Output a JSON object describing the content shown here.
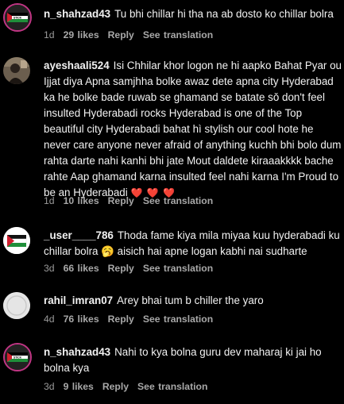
{
  "comments": [
    {
      "username": "n_shahzad43",
      "text": "Tu bhi chillar hi tha na ab dosto ko chillar bolra",
      "time": "1d",
      "likes": "29 likes",
      "reply": "Reply",
      "see_translation": "See translation",
      "avatar_icon": "flag-avatar-icon"
    },
    {
      "username": "ayeshaali524",
      "text": "Isi Chhilar khor logon ne hi aapko Bahat Pyar ou Ijjat diya Apna samjhha bolke awaz dete apna city Hyderabad ka he bolke bade ruwab se ghamand se batate sǒ don't feel insulted Hyderabadi rocks Hyderabad is one of the Top beautiful city Hyderabadi bahat hì stylish our cool hote he never care anyone never afraid of anything kuchh bhi bolo dum rahta darte nahi kanhi bhi jate Mout daldete kiraaakkkk bache rahte Aap ghamand karna insulted feel nahi karna I'm Proud to be an Hyderabadi",
      "emoji": "❤️ ❤️ ❤️",
      "time": "1d",
      "likes": "10 likes",
      "reply": "Reply",
      "see_translation": "See translation",
      "avatar_icon": "profile-photo-icon"
    },
    {
      "username": "_user____786",
      "text": "Thoda fame kiya mila miyaa kuu hyderabadi ku chillar bolra",
      "emoji": "🥱",
      "text2": "aisich hai apne logan kabhi nai sudharte",
      "time": "3d",
      "likes": "66 likes",
      "reply": "Reply",
      "see_translation": "See translation",
      "avatar_icon": "flag-avatar-icon"
    },
    {
      "username": "rahil_imran07",
      "text": "Arey bhai tum b chiller the yaro",
      "time": "4d",
      "likes": "76 likes",
      "reply": "Reply",
      "see_translation": "See translation",
      "avatar_icon": "default-avatar-icon"
    },
    {
      "username": "n_shahzad43",
      "text": "Nahi to kya bolna guru dev maharaj ki jai ho bolna kya",
      "time": "3d",
      "likes": "9 likes",
      "reply": "Reply",
      "see_translation": "See translation",
      "avatar_icon": "flag-avatar-icon"
    }
  ]
}
